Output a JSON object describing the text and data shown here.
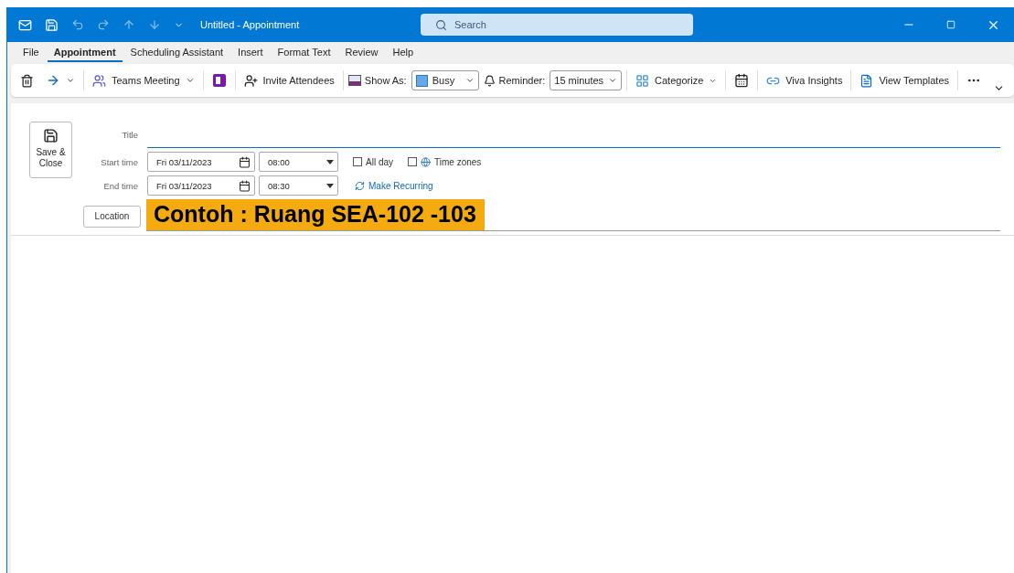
{
  "window": {
    "title": "Untitled  -  Appointment",
    "search_placeholder": "Search"
  },
  "tabs": [
    {
      "label": "File",
      "selected": false
    },
    {
      "label": "Appointment",
      "selected": true
    },
    {
      "label": "Scheduling Assistant",
      "selected": false
    },
    {
      "label": "Insert",
      "selected": false
    },
    {
      "label": "Format Text",
      "selected": false
    },
    {
      "label": "Review",
      "selected": false
    },
    {
      "label": "Help",
      "selected": false
    }
  ],
  "toolbar": {
    "teams_meeting": "Teams Meeting",
    "invite_attendees": "Invite Attendees",
    "show_as": {
      "label": "Show As:",
      "value": "Busy"
    },
    "reminder": {
      "label": "Reminder:",
      "value": "15 minutes"
    },
    "categorize": "Categorize",
    "viva_insights": "Viva Insights",
    "view_templates": "View Templates"
  },
  "form": {
    "save_close": "Save & Close",
    "title_label": "Title",
    "start": {
      "label": "Start time",
      "date": "Fri 03/11/2023",
      "time": "08:00"
    },
    "end": {
      "label": "End time",
      "date": "Fri 03/11/2023",
      "time": "08:30"
    },
    "all_day": {
      "label": "All day",
      "checked": false
    },
    "time_zones": {
      "label": "Time zones",
      "checked": false
    },
    "make_recurring": "Make Recurring",
    "location": {
      "button": "Location",
      "value": "Contoh : Ruang SEA-102 -103"
    }
  }
}
